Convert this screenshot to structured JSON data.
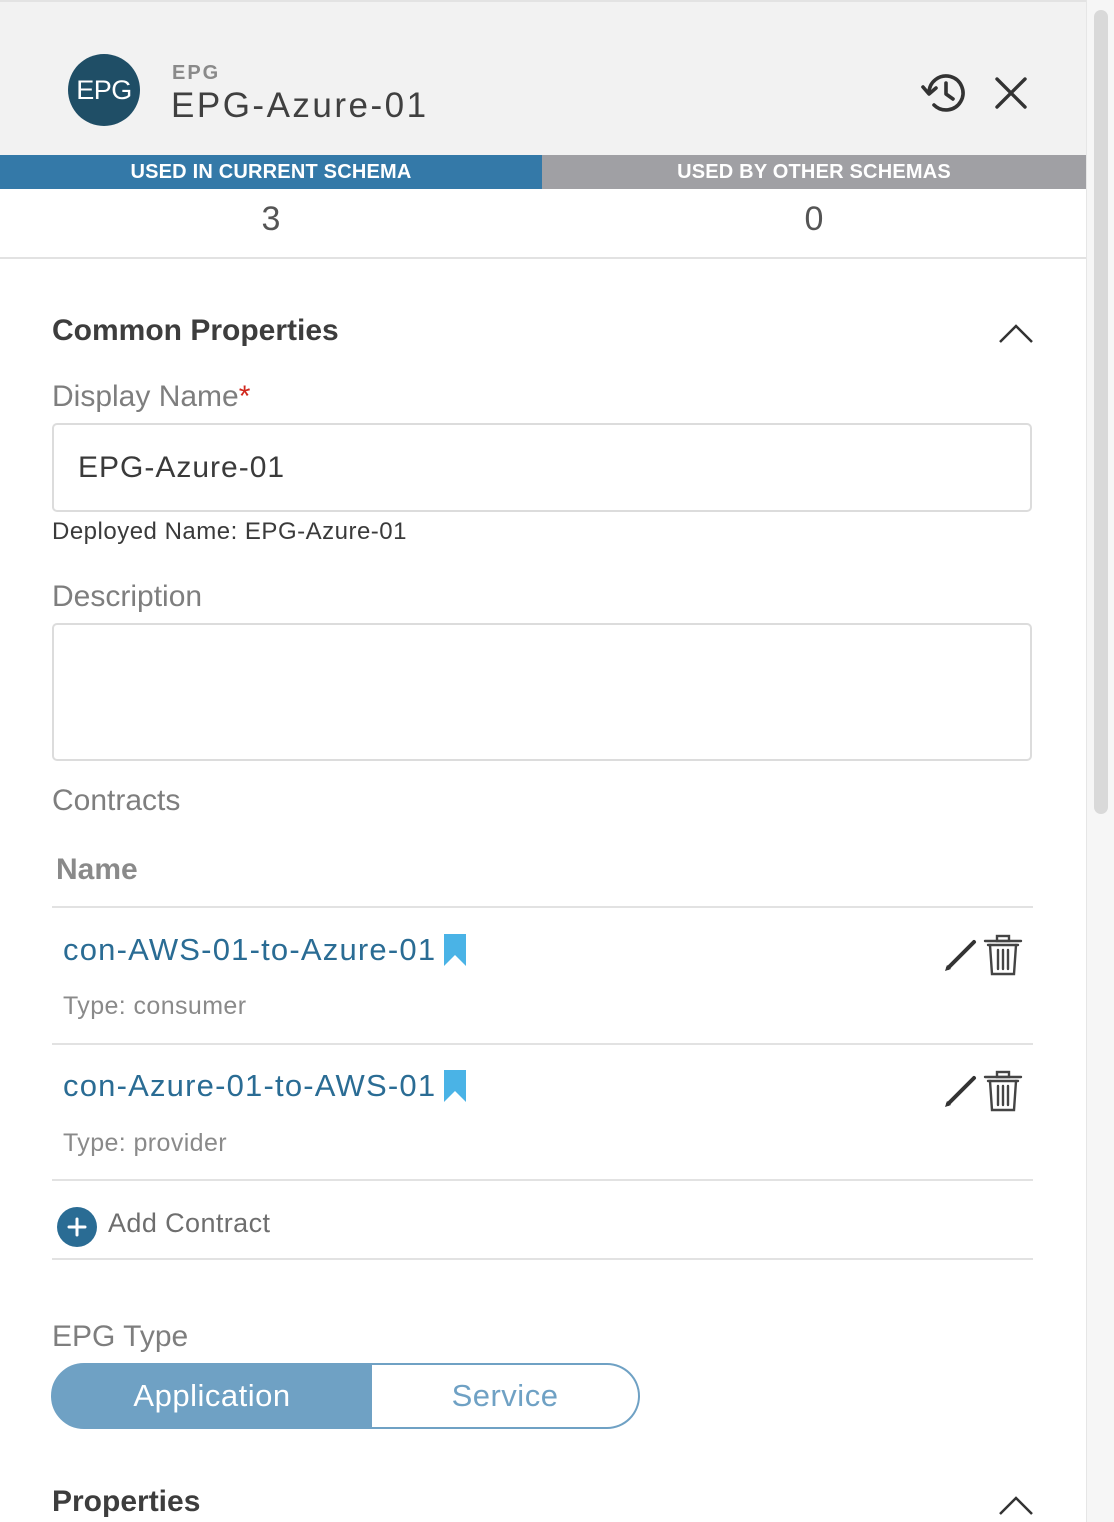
{
  "header": {
    "avatar_text": "EPG",
    "object_type": "EPG",
    "object_name": "EPG-Azure-01"
  },
  "usage": {
    "current_label": "USED IN CURRENT SCHEMA",
    "current_count": "3",
    "other_label": "USED BY OTHER SCHEMAS",
    "other_count": "0"
  },
  "common": {
    "title": "Common Properties",
    "display_name_label": "Display Name",
    "required_mark": "*",
    "display_name_value": "EPG-Azure-01",
    "deployed_name": "Deployed Name: EPG-Azure-01",
    "description_label": "Description",
    "description_value": ""
  },
  "contracts": {
    "label": "Contracts",
    "column_name": "Name",
    "rows": [
      {
        "name": "con-AWS-01-to-Azure-01",
        "type": "Type: consumer"
      },
      {
        "name": "con-Azure-01-to-AWS-01",
        "type": "Type: provider"
      }
    ],
    "add_label": "Add Contract"
  },
  "epg_type": {
    "label": "EPG Type",
    "options": [
      "Application",
      "Service"
    ],
    "selected": "Application"
  },
  "properties": {
    "title": "Properties"
  },
  "colors": {
    "accent": "#3479a8",
    "link": "#2a6c94",
    "bookmark": "#4ab3e6",
    "segment": "#6fa1c4",
    "avatar": "#1f4e66"
  }
}
